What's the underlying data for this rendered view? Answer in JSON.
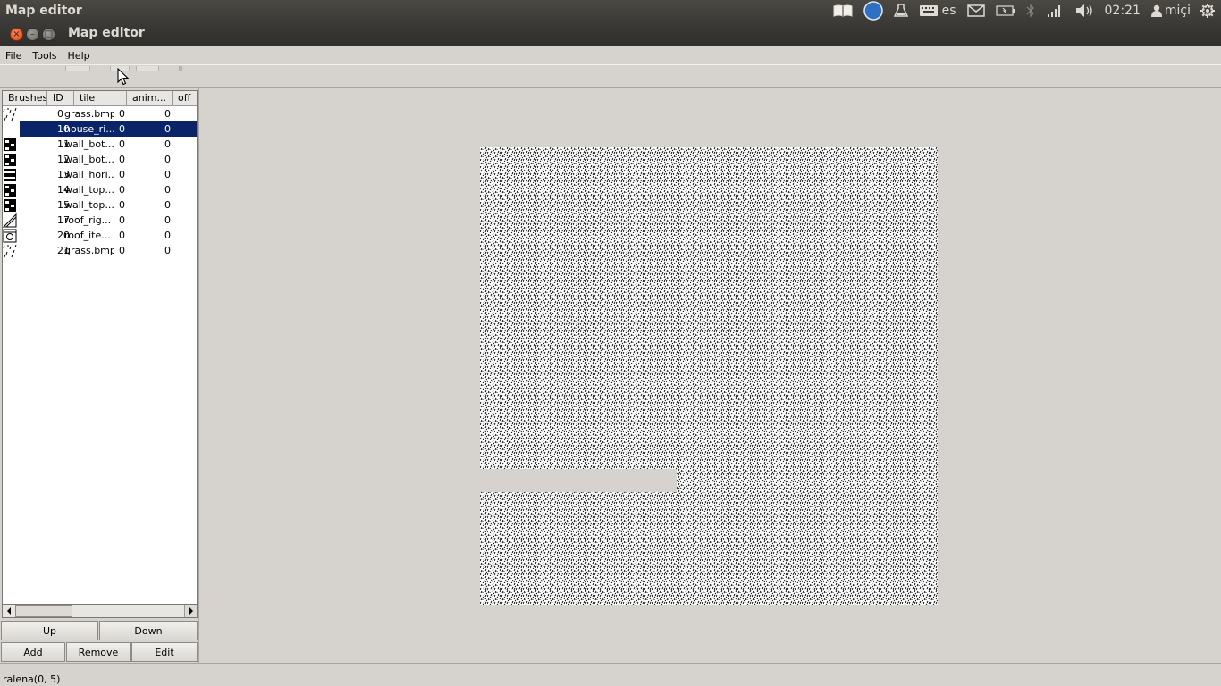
{
  "top_panel": {
    "app_name": "Map editor",
    "keyboard_layout": "es",
    "clock": "02:21",
    "user": "miçi",
    "icons": [
      "book-icon",
      "browser-icon",
      "flask-icon",
      "keyboard-icon",
      "mail-icon",
      "battery-icon",
      "bluetooth-icon",
      "network-signal-icon",
      "volume-icon",
      "user-icon",
      "settings-gear-icon"
    ]
  },
  "window": {
    "title": "Map editor",
    "close_glyph": "×",
    "minimize_glyph": "–",
    "maximize_glyph": "□"
  },
  "menubar": {
    "items": [
      "File",
      "Tools",
      "Help"
    ]
  },
  "brushes_table": {
    "columns": [
      "Brushes",
      "ID",
      "tile",
      "anim...",
      "off"
    ],
    "rows": [
      {
        "icon": "grass",
        "id": "0",
        "tile": "grass.bmp",
        "anim": "0",
        "off": "0",
        "selected": false
      },
      {
        "icon": "none",
        "id": "10",
        "tile": "house_ri...",
        "anim": "0",
        "off": "0",
        "selected": true
      },
      {
        "icon": "wall",
        "id": "11",
        "tile": "wall_bot...",
        "anim": "0",
        "off": "0",
        "selected": false
      },
      {
        "icon": "wall",
        "id": "12",
        "tile": "wall_bot...",
        "anim": "0",
        "off": "0",
        "selected": false
      },
      {
        "icon": "wall-horizontal",
        "id": "13",
        "tile": "wall_hori...",
        "anim": "0",
        "off": "0",
        "selected": false
      },
      {
        "icon": "wall",
        "id": "14",
        "tile": "wall_top...",
        "anim": "0",
        "off": "0",
        "selected": false
      },
      {
        "icon": "wall",
        "id": "15",
        "tile": "wall_top...",
        "anim": "0",
        "off": "0",
        "selected": false
      },
      {
        "icon": "roof",
        "id": "17",
        "tile": "roof_rig...",
        "anim": "0",
        "off": "0",
        "selected": false
      },
      {
        "icon": "roof-item",
        "id": "20",
        "tile": "roof_ite...",
        "anim": "0",
        "off": "0",
        "selected": false
      },
      {
        "icon": "grass",
        "id": "21",
        "tile": "grass.bmp",
        "anim": "0",
        "off": "0",
        "selected": false
      }
    ]
  },
  "buttons": {
    "up": "Up",
    "down": "Down",
    "add": "Add",
    "remove": "Remove",
    "edit": "Edit"
  },
  "status_bar": {
    "text": "ralena(0, 5)"
  },
  "colors": {
    "panel_bg": "#3c3b37",
    "window_bg": "#d6d3ce",
    "selection": "#0a246a",
    "close_button": "#df4a16"
  }
}
